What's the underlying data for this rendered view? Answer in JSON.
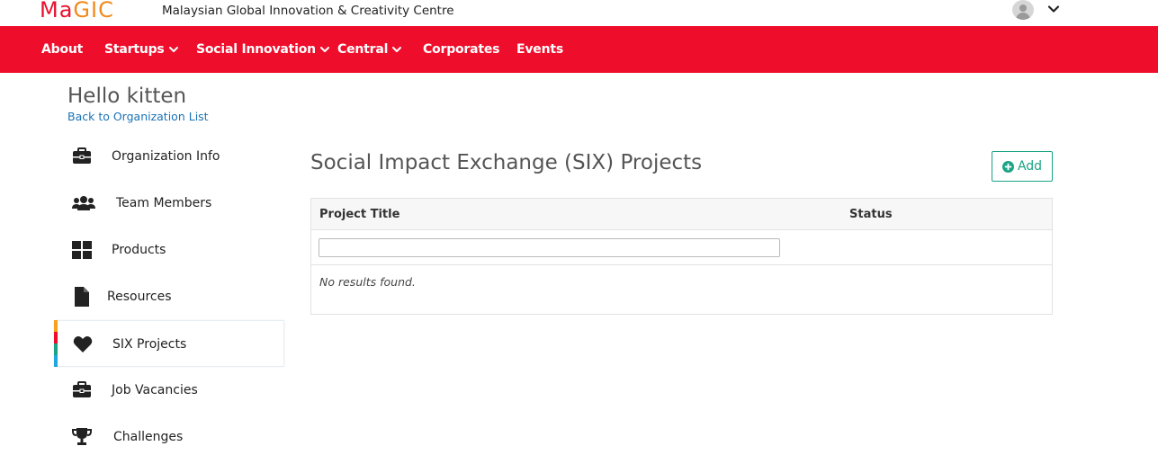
{
  "brand": {
    "logo_part1": "Ma",
    "logo_part2": "GIC",
    "site_name": "Malaysian Global Innovation & Creativity Centre"
  },
  "user_menu": {
    "avatar_icon": "user-avatar-icon",
    "chevron_icon": "chevron-down-icon"
  },
  "nav": {
    "items": [
      {
        "label": "About",
        "dropdown": false
      },
      {
        "label": "Startups",
        "dropdown": true
      },
      {
        "label": "Social Innovation",
        "dropdown": true
      },
      {
        "label": "Central",
        "dropdown": true
      },
      {
        "label": "Corporates",
        "dropdown": false
      },
      {
        "label": "Events",
        "dropdown": false
      }
    ]
  },
  "header": {
    "greeting": "Hello kitten",
    "back_link": "Back to Organization List"
  },
  "sidebar": {
    "items": [
      {
        "label": "Organization Info",
        "icon": "briefcase-icon"
      },
      {
        "label": "Team Members",
        "icon": "users-icon"
      },
      {
        "label": "Products",
        "icon": "grid-icon"
      },
      {
        "label": "Resources",
        "icon": "file-icon"
      },
      {
        "label": "SIX Projects",
        "icon": "heart-icon",
        "active": true
      },
      {
        "label": "Job Vacancies",
        "icon": "briefcase-icon"
      },
      {
        "label": "Challenges",
        "icon": "trophy-icon"
      }
    ]
  },
  "main": {
    "title": "Social Impact Exchange (SIX) Projects",
    "add_button": "Add",
    "table": {
      "columns": [
        "Project Title",
        "Status"
      ],
      "filter_value": "",
      "empty_text": "No results found."
    }
  },
  "colors": {
    "nav_bg": "#ee0e2b",
    "link": "#1a73b5",
    "add_button": "#1aa384",
    "active_stripe": [
      "#f7a21b",
      "#ee0e2b",
      "#1aa384",
      "#1fa8e0"
    ]
  }
}
